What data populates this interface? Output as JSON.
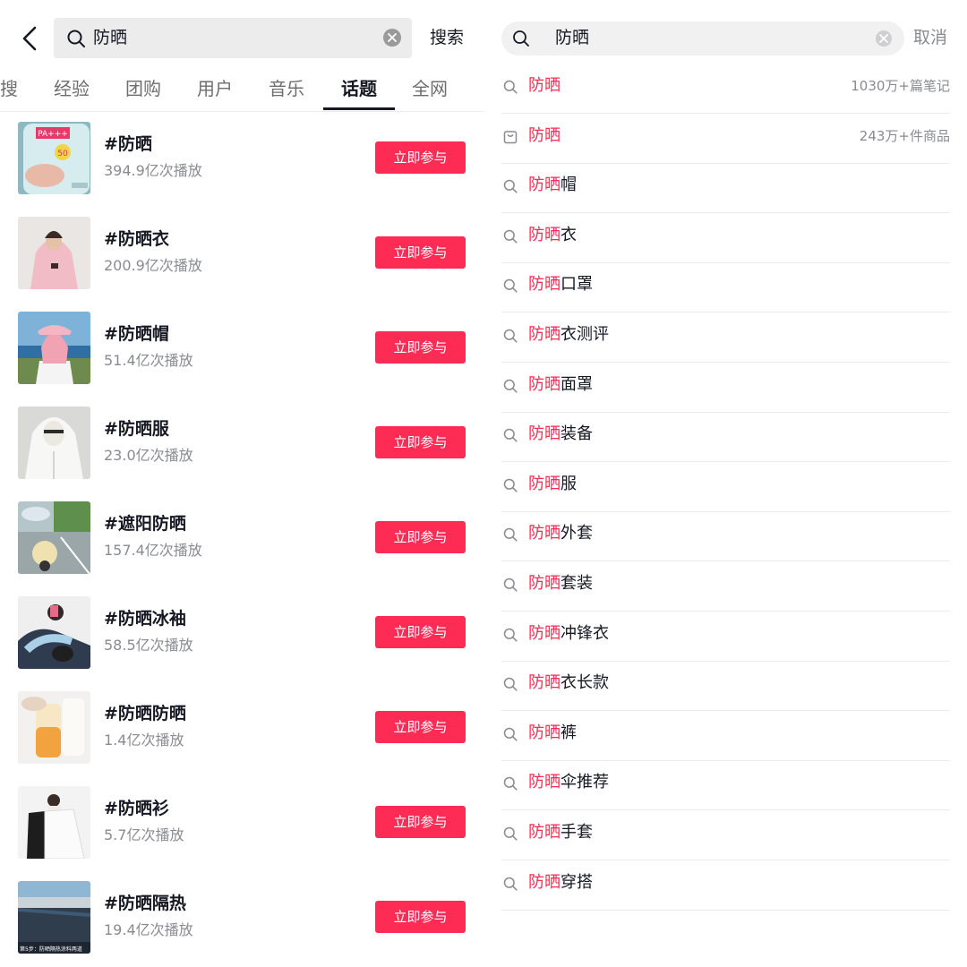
{
  "left": {
    "search": {
      "query": "防晒",
      "button": "搜索"
    },
    "tabs": [
      {
        "label": "搜"
      },
      {
        "label": "经验"
      },
      {
        "label": "团购"
      },
      {
        "label": "用户"
      },
      {
        "label": "音乐"
      },
      {
        "label": "话题",
        "active": true
      },
      {
        "label": "全网"
      }
    ],
    "topics": [
      {
        "name": "#防晒",
        "plays": "394.9亿次播放",
        "action": "立即参与"
      },
      {
        "name": "#防晒衣",
        "plays": "200.9亿次播放",
        "action": "立即参与"
      },
      {
        "name": "#防晒帽",
        "plays": "51.4亿次播放",
        "action": "立即参与"
      },
      {
        "name": "#防晒服",
        "plays": "23.0亿次播放",
        "action": "立即参与"
      },
      {
        "name": "#遮阳防晒",
        "plays": "157.4亿次播放",
        "action": "立即参与"
      },
      {
        "name": "#防晒冰袖",
        "plays": "58.5亿次播放",
        "action": "立即参与"
      },
      {
        "name": "#防晒防晒",
        "plays": "1.4亿次播放",
        "action": "立即参与"
      },
      {
        "name": "#防晒衫",
        "plays": "5.7亿次播放",
        "action": "立即参与"
      },
      {
        "name": "#防晒隔热",
        "plays": "19.4亿次播放",
        "action": "立即参与"
      }
    ],
    "thumbnail_texts": [
      "PA+++",
      "50",
      "第5步：防晒隔热涂料两道"
    ]
  },
  "right": {
    "search": {
      "query": "防晒",
      "cancel": "取消"
    },
    "highlight": "防晒",
    "suggestions": [
      {
        "rest": "",
        "count": "1030万+篇笔记",
        "icon": "search-icon"
      },
      {
        "rest": "",
        "count": "243万+件商品",
        "icon": "shopping-bag-icon"
      },
      {
        "rest": "帽",
        "icon": "search-icon"
      },
      {
        "rest": "衣",
        "icon": "search-icon"
      },
      {
        "rest": "口罩",
        "icon": "search-icon"
      },
      {
        "rest": "衣测评",
        "icon": "search-icon"
      },
      {
        "rest": "面罩",
        "icon": "search-icon"
      },
      {
        "rest": "装备",
        "icon": "search-icon"
      },
      {
        "rest": "服",
        "icon": "search-icon"
      },
      {
        "rest": "外套",
        "icon": "search-icon"
      },
      {
        "rest": "套装",
        "icon": "search-icon"
      },
      {
        "rest": "冲锋衣",
        "icon": "search-icon"
      },
      {
        "rest": "衣长款",
        "icon": "search-icon"
      },
      {
        "rest": "裤",
        "icon": "search-icon"
      },
      {
        "rest": "伞推荐",
        "icon": "search-icon"
      },
      {
        "rest": "手套",
        "icon": "search-icon"
      },
      {
        "rest": "穿搭",
        "icon": "search-icon"
      }
    ]
  },
  "colors": {
    "accent": "#fe2c55",
    "text": "#161823",
    "secondary": "#8a8b91",
    "divider": "#ececec"
  }
}
